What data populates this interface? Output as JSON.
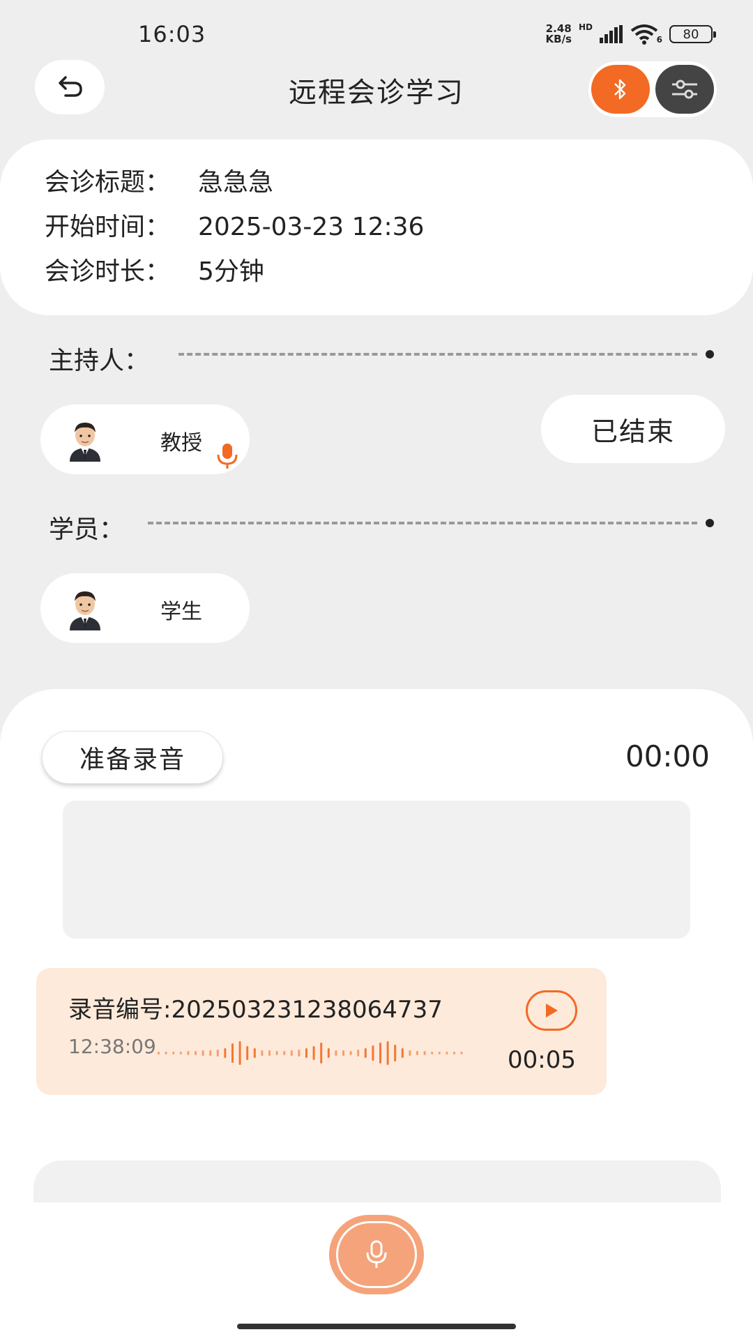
{
  "status_bar": {
    "time": "16:03",
    "net_speed_value": "2.48",
    "net_speed_unit": "KB/s",
    "hd_label": "HD",
    "wifi_badge": "6",
    "battery": "80"
  },
  "header": {
    "title": "远程会诊学习",
    "back_icon": "undo-arrow-icon",
    "bluetooth_icon": "bluetooth-icon",
    "settings_icon": "sliders-icon",
    "accent_color": "#f26a23"
  },
  "info": {
    "title_label": "会诊标题：",
    "title_value": "急急急",
    "start_label": "开始时间：",
    "start_value": "2025-03-23 12:36",
    "duration_label": "会诊时长：",
    "duration_value": "5分钟"
  },
  "host": {
    "label": "主持人：",
    "name": "教授",
    "status": "已结束"
  },
  "students": {
    "label": "学员：",
    "name": "学生"
  },
  "recording": {
    "prepare_label": "准备录音",
    "timer": "00:00",
    "item": {
      "id_label": "录音编号:202503231238064737",
      "time": "12:38:09",
      "duration": "00:05"
    }
  }
}
